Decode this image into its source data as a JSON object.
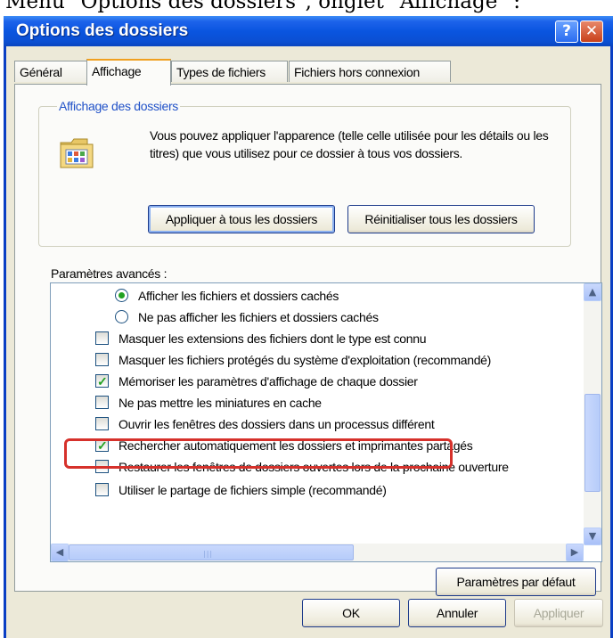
{
  "caption": "Menu \"Options des dossiers\", onglet \"Affichage\" :",
  "window": {
    "title": "Options des dossiers",
    "help_glyph": "?",
    "close_glyph": "✕"
  },
  "tabs": [
    {
      "label": "Général",
      "active": false
    },
    {
      "label": "Affichage",
      "active": true
    },
    {
      "label": "Types de fichiers",
      "active": false
    },
    {
      "label": "Fichiers hors connexion",
      "active": false
    }
  ],
  "folder_view": {
    "legend": "Affichage des dossiers",
    "description": "Vous pouvez appliquer l'apparence (telle celle utilisée pour les détails ou les titres) que vous utilisez pour ce dossier à tous vos dossiers.",
    "apply_all_label": "Appliquer à tous les dossiers",
    "reset_all_label": "Réinitialiser tous les dossiers"
  },
  "advanced": {
    "label": "Paramètres avancés :",
    "items": [
      {
        "type": "radio",
        "checked": true,
        "label": "Afficher les fichiers et dossiers cachés"
      },
      {
        "type": "radio",
        "checked": false,
        "label": "Ne pas afficher les fichiers et dossiers cachés"
      },
      {
        "type": "checkbox",
        "checked": false,
        "label": "Masquer les extensions des fichiers dont le type est connu"
      },
      {
        "type": "checkbox",
        "checked": false,
        "label": "Masquer les fichiers protégés du système d'exploitation (recommandé)"
      },
      {
        "type": "checkbox",
        "checked": true,
        "label": "Mémoriser les paramètres d'affichage de chaque dossier"
      },
      {
        "type": "checkbox",
        "checked": false,
        "label": "Ne pas mettre les miniatures en cache"
      },
      {
        "type": "checkbox",
        "checked": false,
        "label": "Ouvrir les fenêtres des dossiers dans un processus différent"
      },
      {
        "type": "checkbox",
        "checked": true,
        "label": "Rechercher automatiquement les dossiers et imprimantes partagés"
      },
      {
        "type": "checkbox",
        "checked": false,
        "label": "Restaurer les fenêtres de dossiers ouvertes lors de la prochaine ouverture"
      },
      {
        "type": "checkbox",
        "checked": false,
        "label": "Utiliser le partage de fichiers simple (recommandé)"
      }
    ]
  },
  "buttons": {
    "defaults": "Paramètres par défaut",
    "ok": "OK",
    "cancel": "Annuler",
    "apply": "Appliquer"
  },
  "colors": {
    "title_bar": "#0a55e0",
    "highlight": "#d6312b",
    "check_mark": "#21a121"
  }
}
